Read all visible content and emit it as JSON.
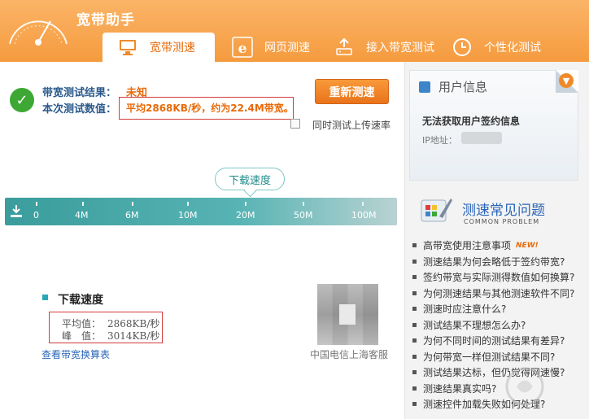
{
  "app": {
    "title": "宽带助手"
  },
  "tabs": [
    {
      "label": "宽带测速",
      "icon": "monitor-icon",
      "active": true
    },
    {
      "label": "网页测速",
      "icon": "ie-browser-icon",
      "active": false
    },
    {
      "label": "接入带宽测试",
      "icon": "router-icon",
      "active": false
    },
    {
      "label": "个性化测试",
      "icon": "clock-icon",
      "active": false
    }
  ],
  "result": {
    "test_result_label": "带宽测试结果：",
    "test_result_value": "未知",
    "current_value_label": "本次测试数值：",
    "current_value_text": "平均2868KB/秒，约为22.4M带宽。",
    "retest_button": "重新测速",
    "upload_checkbox_label": "同时测试上传速率",
    "upload_checkbox_checked": false
  },
  "speedometer": {
    "bubble_label": "下载速度",
    "ticks": [
      "0",
      "4M",
      "6M",
      "10M",
      "20M",
      "50M",
      "100M"
    ],
    "bar_color": "#3a9c9c"
  },
  "download": {
    "title": "下载速度",
    "avg_label": "平均值：",
    "avg_value": "2868KB/秒",
    "peak_label": "峰　值：",
    "peak_value": "3014KB/秒",
    "calc_link": "查看带宽换算表",
    "isp_label": "中国电信上海客服"
  },
  "user_info": {
    "title": "用户信息",
    "message": "无法获取用户签约信息",
    "ip_label": "IP地址："
  },
  "faq": {
    "title": "测速常见问题",
    "subtitle": "COMMON PROBLEM",
    "new_tag": "NEW!",
    "items": [
      "高带宽使用注意事项",
      "测速结果为何会略低于签约带宽?",
      "签约带宽与实际测得数值如何换算?",
      "为何测速结果与其他测速软件不同?",
      "测速时应注意什么?",
      "测试结果不理想怎么办?",
      "为何不同时间的测试结果有差异?",
      "为何带宽一样但测试结果不同?",
      "测试结果达标，但仍觉得网速慢?",
      "测速结果真实吗?",
      "测速控件加载失败如何处理?"
    ]
  },
  "colors": {
    "accent": "#f59b3f",
    "link": "#2a66b8",
    "highlight": "#e86a0a",
    "success": "#3da833"
  }
}
